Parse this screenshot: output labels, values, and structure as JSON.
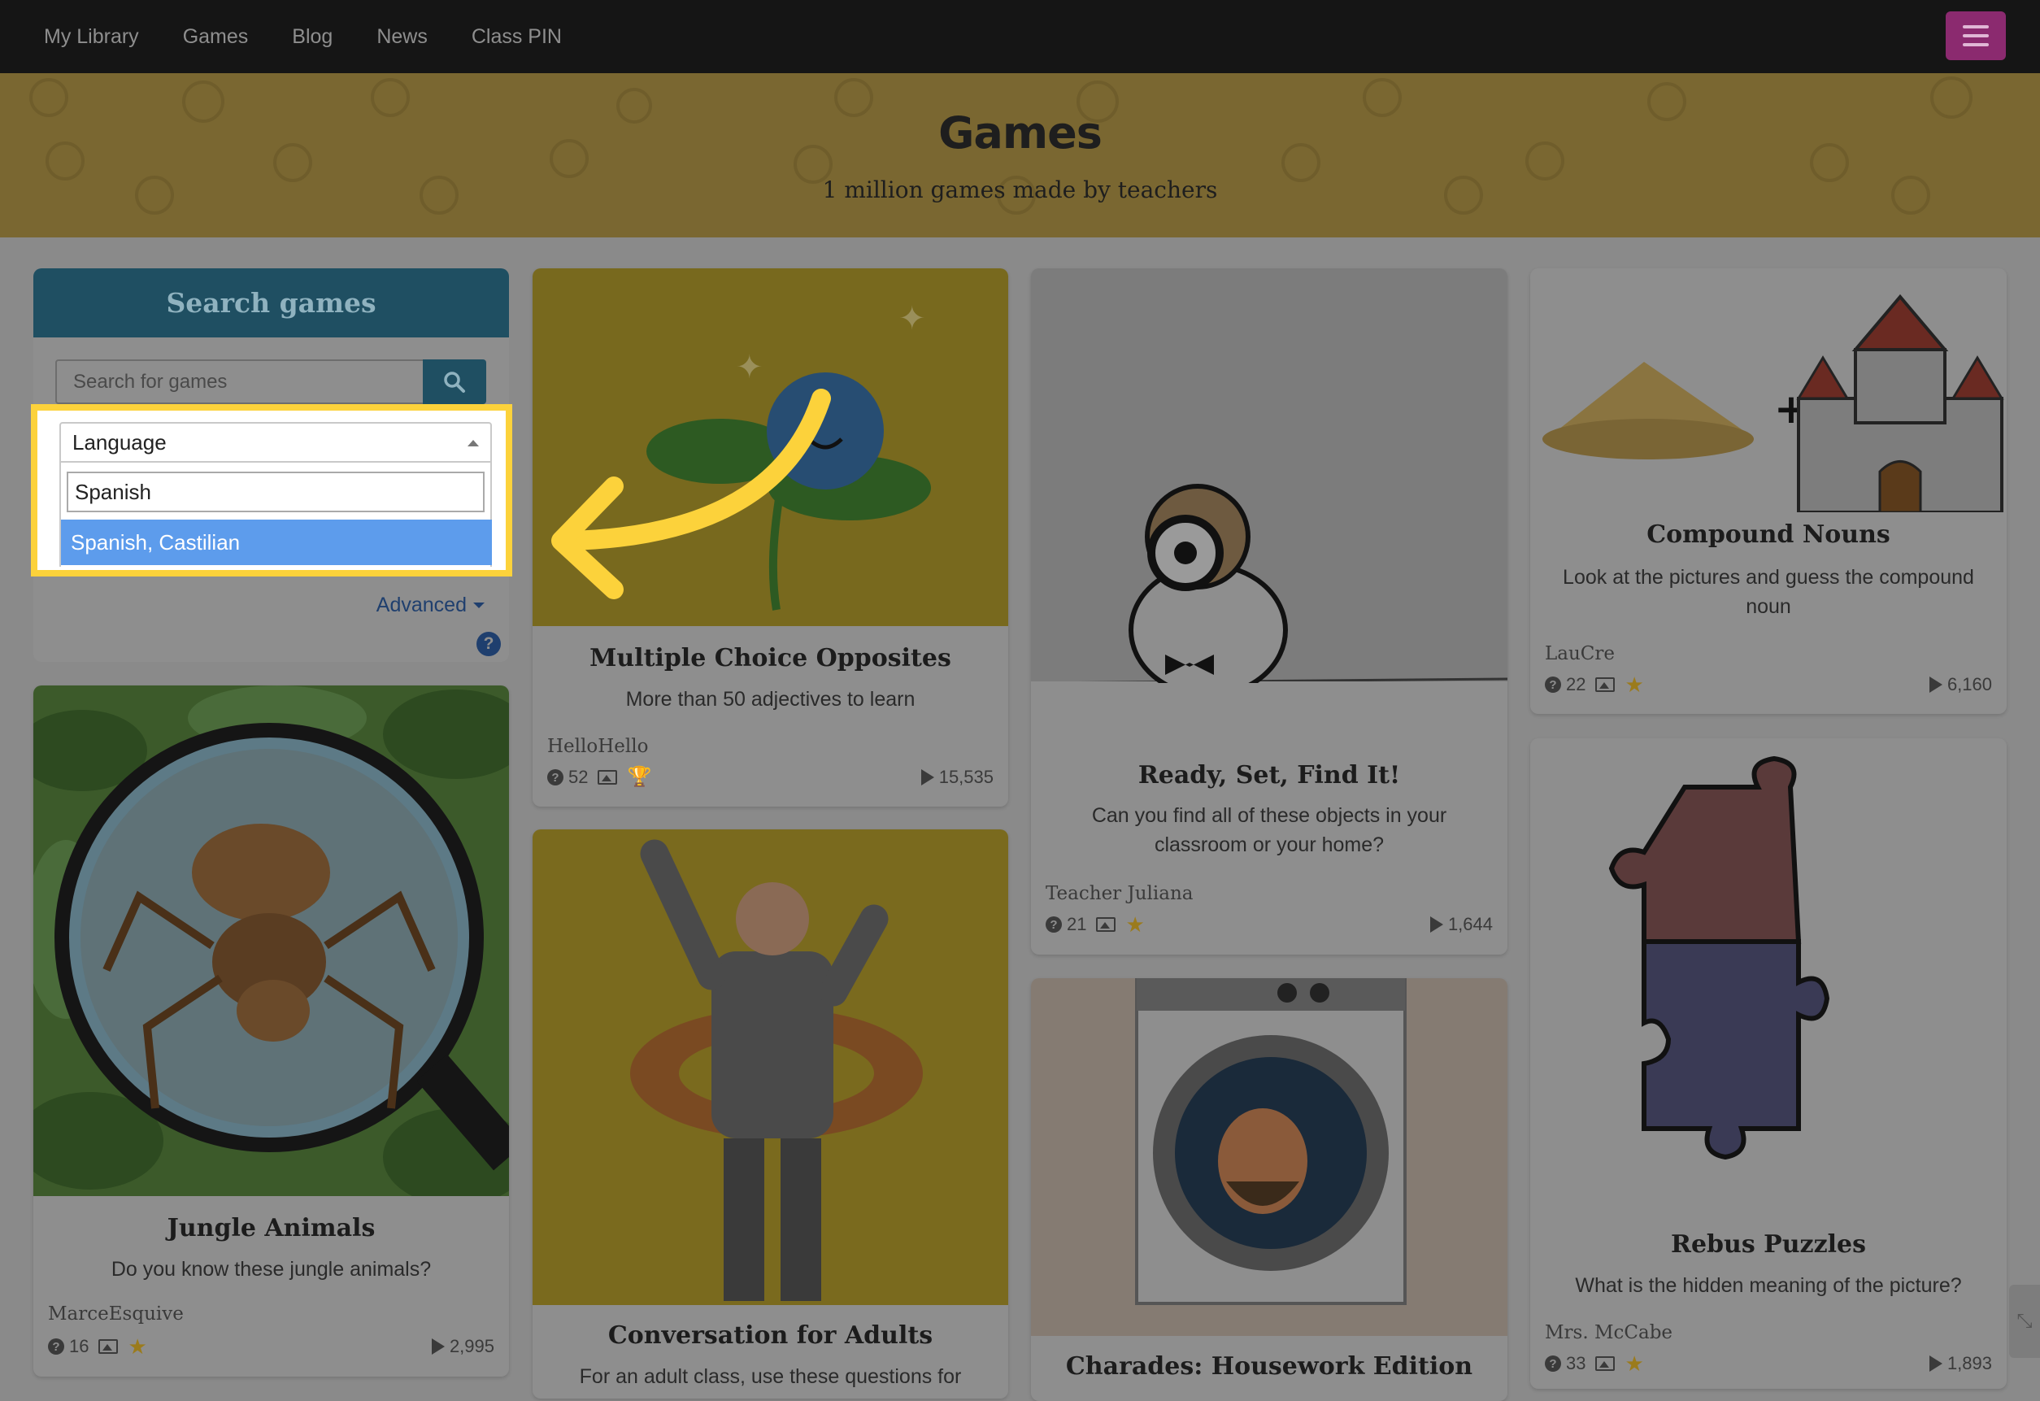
{
  "nav": {
    "items": [
      "My Library",
      "Games",
      "Blog",
      "News",
      "Class PIN"
    ],
    "menu_icon": "hamburger-icon"
  },
  "hero": {
    "title": "Games",
    "subtitle": "1 million games made by teachers"
  },
  "search": {
    "title": "Search games",
    "placeholder": "Search for games",
    "search_icon": "search-icon",
    "advanced_label": "Advanced",
    "help_label": "?"
  },
  "language_dropdown": {
    "label": "Language",
    "query": "Spanish",
    "highlighted_option": "Spanish, Castilian"
  },
  "cards": [
    {
      "title": "Jungle Animals",
      "desc": "Do you know these jungle animals?",
      "author": "MarceEsquive",
      "questions": "16",
      "plays": "2,995",
      "badge": "star"
    },
    {
      "title": "Multiple Choice Opposites",
      "desc": "More than 50 adjectives to learn",
      "author": "HelloHello",
      "questions": "52",
      "plays": "15,535",
      "badge": "trophy"
    },
    {
      "title": "Conversation for Adults",
      "desc": "For an adult class, use these questions for"
    },
    {
      "title": "Ready, Set, Find It!",
      "desc": "Can you find all of these objects in your classroom or your home?",
      "author": "Teacher Juliana",
      "questions": "21",
      "plays": "1,644",
      "badge": "star"
    },
    {
      "title": "Charades: Housework Edition"
    },
    {
      "title": "Compound Nouns",
      "desc": "Look at the pictures and guess the compound noun",
      "author": "LauCre",
      "questions": "22",
      "plays": "6,160",
      "badge": "star"
    },
    {
      "title": "Rebus Puzzles",
      "desc": "What is the hidden meaning of the picture?",
      "author": "Mrs. McCabe",
      "questions": "33",
      "plays": "1,893",
      "badge": "star"
    }
  ],
  "colors": {
    "accent_highlight": "#fcd23b",
    "selected_option": "#5d9cec",
    "search_header": "#1f4f62",
    "menu_button": "#8b2a6f"
  }
}
